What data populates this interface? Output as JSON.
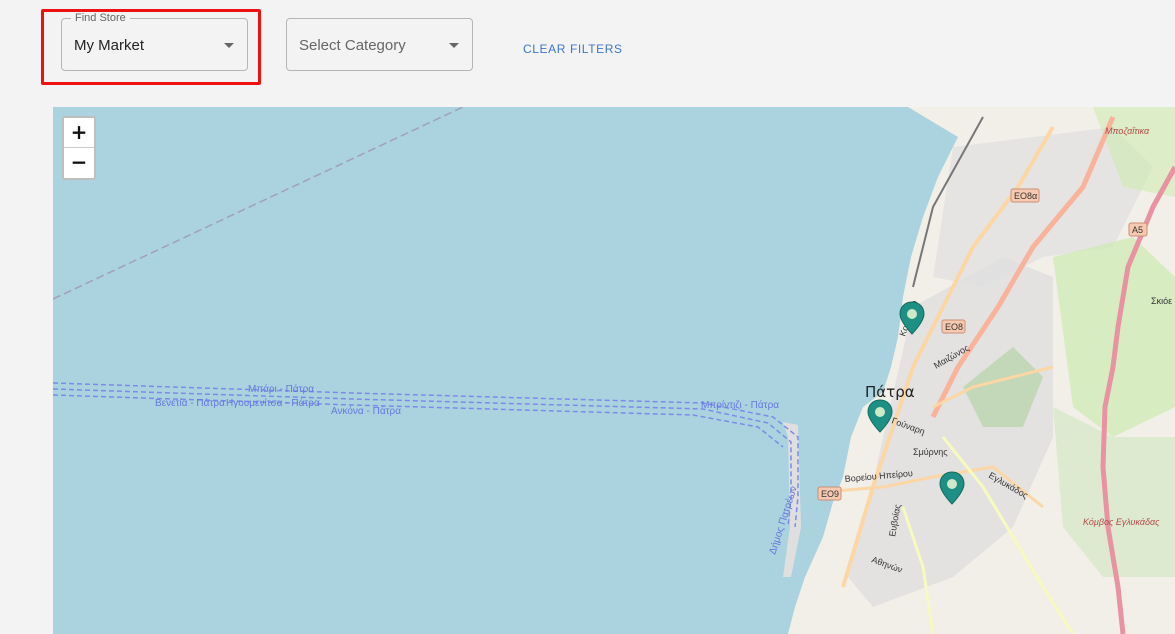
{
  "filters": {
    "find_store_label": "Find Store",
    "find_store_value": "My Market",
    "category_placeholder": "Select Category",
    "clear_filters_label": "CLEAR FILTERS"
  },
  "map": {
    "zoom_in_label": "+",
    "zoom_out_label": "−",
    "city_label": "Πάτρα",
    "ferry_routes": [
      "Μπάρι - Πάτρα",
      "Βενετία - Πάτρα",
      "Ηγουμενίτσα - Πάτρα",
      "Ανκόνα - Πάτρα",
      "Μπρίντιζι - Πάτρα"
    ],
    "port_label": "Δήμος Πατρέων",
    "shields": [
      "ΕΟ8α",
      "ΕΟ8",
      "ΕΟ9",
      "Α5"
    ],
    "places": [
      "Μποζαΐτικα",
      "Σκιόε",
      "Κόμβος Εγλυκάδας"
    ],
    "streets": [
      "Κορίνθου",
      "Μαιζώνος",
      "Γούναρη",
      "Σμύρνης",
      "Βορείου Ηπείρου",
      "Αθηνών",
      "Ευβοίας",
      "Εγλυκάδος"
    ],
    "markers": 3
  },
  "colors": {
    "marker": "#1d8f84",
    "highlight": "#ee1111",
    "link": "#3f77c4"
  }
}
